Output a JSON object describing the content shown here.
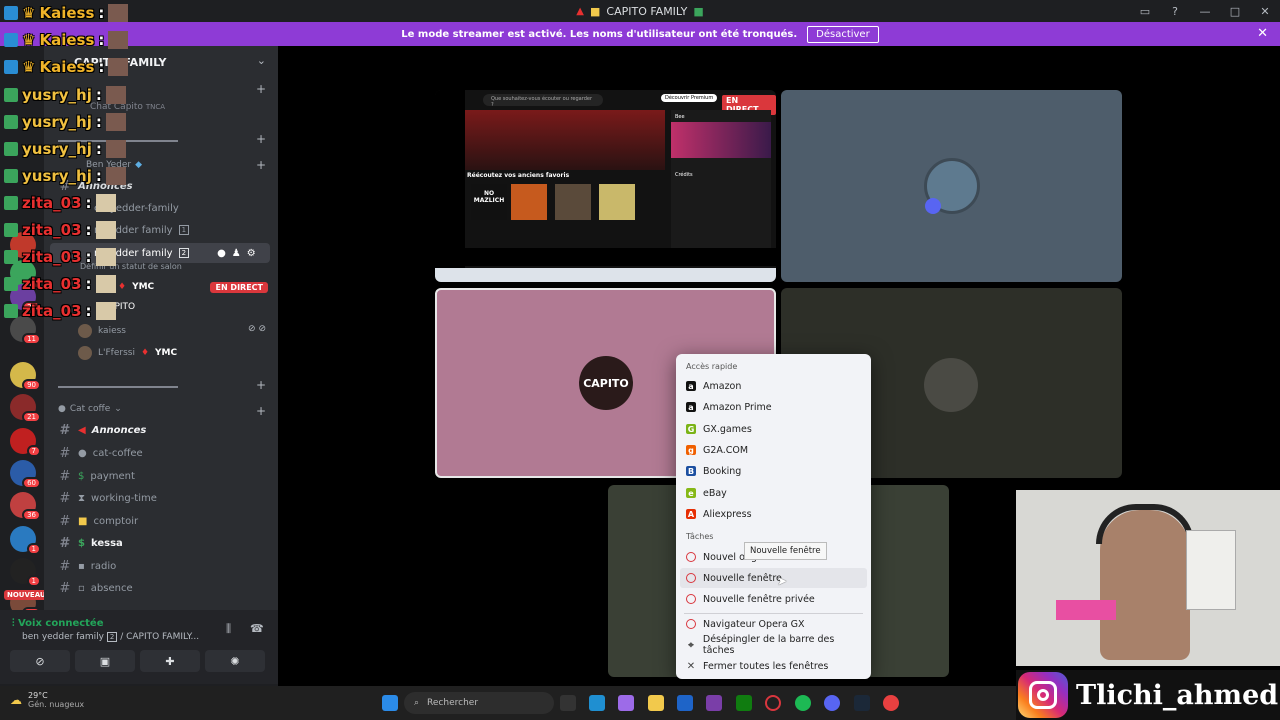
{
  "window": {
    "title": "CAPITO FAMILY"
  },
  "banner": {
    "message": "Le mode streamer est activé. Les noms d'utilisateur ont été tronqués.",
    "button": "Désactiver"
  },
  "server": {
    "name": "CAPITO FAMILY",
    "channels": {
      "chat": "Chat Capito",
      "chat_tag": "TNCA",
      "category1": "Ben Yeder",
      "annonces1": "Annonces",
      "family1": "en-yedder-family",
      "family2": "n yedder family",
      "family2_count": "1",
      "voice_channel": "n yedder family",
      "voice_channel_count": "2",
      "status_hint": "Définir un statut de salon",
      "live_badge": "EN DIRECT",
      "user_ymc": "YMC",
      "user_capito": "CAPITO",
      "user_kaiess": "kaiess",
      "user_lfersi": "L'Fferssi",
      "user_lfersi_tag": "YMC",
      "category2": "Cat coffe",
      "list": [
        {
          "name": "Annonces",
          "bold": true
        },
        {
          "name": "cat-coffee",
          "bold": false
        },
        {
          "name": "payment",
          "bold": false
        },
        {
          "name": "working-time",
          "bold": false
        },
        {
          "name": "comptoir",
          "bold": false
        },
        {
          "name": "kessa",
          "bold": true
        },
        {
          "name": "radio",
          "bold": false
        },
        {
          "name": "absence",
          "bold": false
        }
      ]
    }
  },
  "badges": [
    "1",
    "21",
    "11",
    "21",
    "7",
    "60",
    "36",
    "1",
    "1",
    "46",
    "90"
  ],
  "new_badge": "NOUVEAU",
  "voice": {
    "status": "Voix connectée",
    "path": "ben yedder family",
    "path_count": "2",
    "path_server": "CAPITO FAMILY..."
  },
  "overlay_chat": [
    {
      "user": "Kaiess",
      "color": "#f0b429"
    },
    {
      "user": "Kaiess",
      "color": "#f0b429"
    },
    {
      "user": "Kaiess",
      "color": "#f0b429"
    },
    {
      "user": "yusry_hj",
      "color": "#f0c040"
    },
    {
      "user": "yusry_hj",
      "color": "#f0c040"
    },
    {
      "user": "yusry_hj",
      "color": "#f0c040"
    },
    {
      "user": "yusry_hj",
      "color": "#f0c040"
    },
    {
      "user": "zita_03",
      "color": "#e83030"
    },
    {
      "user": "zita_03",
      "color": "#e83030"
    },
    {
      "user": "zita_03",
      "color": "#e83030"
    },
    {
      "user": "zita_03",
      "color": "#e83030"
    },
    {
      "user": "zita_03",
      "color": "#e83030"
    }
  ],
  "overlay_sep": ":",
  "stage": {
    "live": "EN DIRECT",
    "capito": "CAPITO"
  },
  "spotify": {
    "section": "Réécoutez vos anciens favoris",
    "search": "Que souhaitez-vous écouter ou regarder ?",
    "premium": "Découvrir Premium",
    "album": "NO MAZLICH",
    "artist_panel": "Bee",
    "credits": "Crédits"
  },
  "jumplist": {
    "quick_header": "Accès rapide",
    "quick": [
      {
        "label": "Amazon",
        "icon": "a",
        "color": "#111111"
      },
      {
        "label": "Amazon Prime",
        "icon": "a",
        "color": "#111111"
      },
      {
        "label": "GX.games",
        "icon": "G",
        "color": "#7ab317"
      },
      {
        "label": "G2A.COM",
        "icon": "g",
        "color": "#f05f00"
      },
      {
        "label": "Booking",
        "icon": "B",
        "color": "#1c4fa1"
      },
      {
        "label": "eBay",
        "icon": "e",
        "color": "#86b817"
      },
      {
        "label": "Aliexpress",
        "icon": "A",
        "color": "#e62e04"
      }
    ],
    "tasks_header": "Tâches",
    "tasks": [
      {
        "label": "Nouvel onglet"
      },
      {
        "label": "Nouvelle fenêtre"
      },
      {
        "label": "Nouvelle fenêtre privée"
      }
    ],
    "app": "Navigateur Opera GX",
    "unpin": "Désépingler de la barre des tâches",
    "close_all": "Fermer toutes les fenêtres",
    "tooltip": "Nouvelle fenêtre"
  },
  "social": {
    "handle": "Tlichi_ahmed"
  },
  "taskbar": {
    "temp": "29°C",
    "weather": "Gén. nuageux",
    "search": "Rechercher"
  }
}
